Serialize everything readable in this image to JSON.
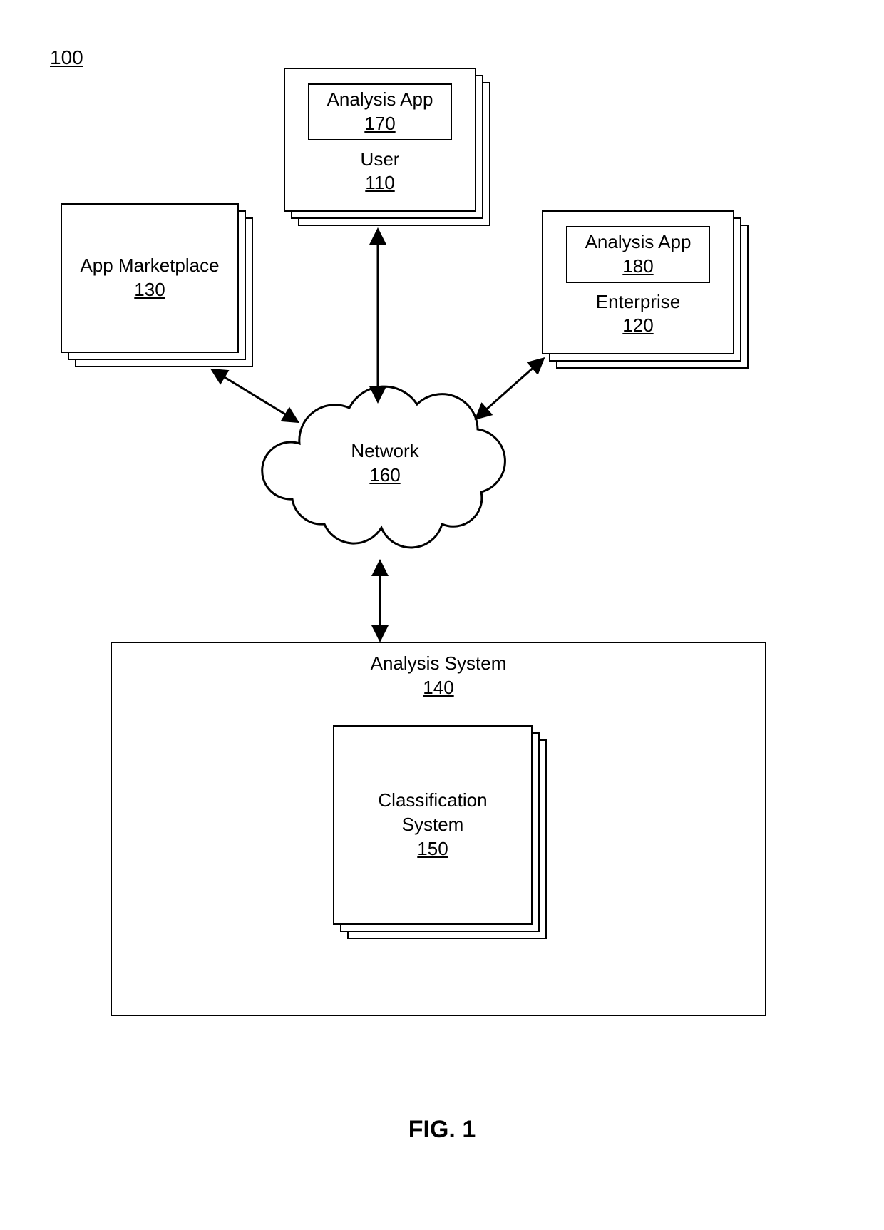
{
  "figure_ref": "100",
  "figure_caption": "FIG. 1",
  "nodes": {
    "user": {
      "inner_label": "Analysis App",
      "inner_ref": "170",
      "label": "User",
      "ref": "110"
    },
    "marketplace": {
      "label": "App Marketplace",
      "ref": "130"
    },
    "enterprise": {
      "inner_label": "Analysis App",
      "inner_ref": "180",
      "label": "Enterprise",
      "ref": "120"
    },
    "network": {
      "label": "Network",
      "ref": "160"
    },
    "analysis_system": {
      "label": "Analysis System",
      "ref": "140"
    },
    "classification": {
      "label": "Classification System",
      "ref": "150"
    }
  },
  "connections": [
    [
      "marketplace",
      "network"
    ],
    [
      "user",
      "network"
    ],
    [
      "enterprise",
      "network"
    ],
    [
      "network",
      "analysis_system"
    ]
  ]
}
